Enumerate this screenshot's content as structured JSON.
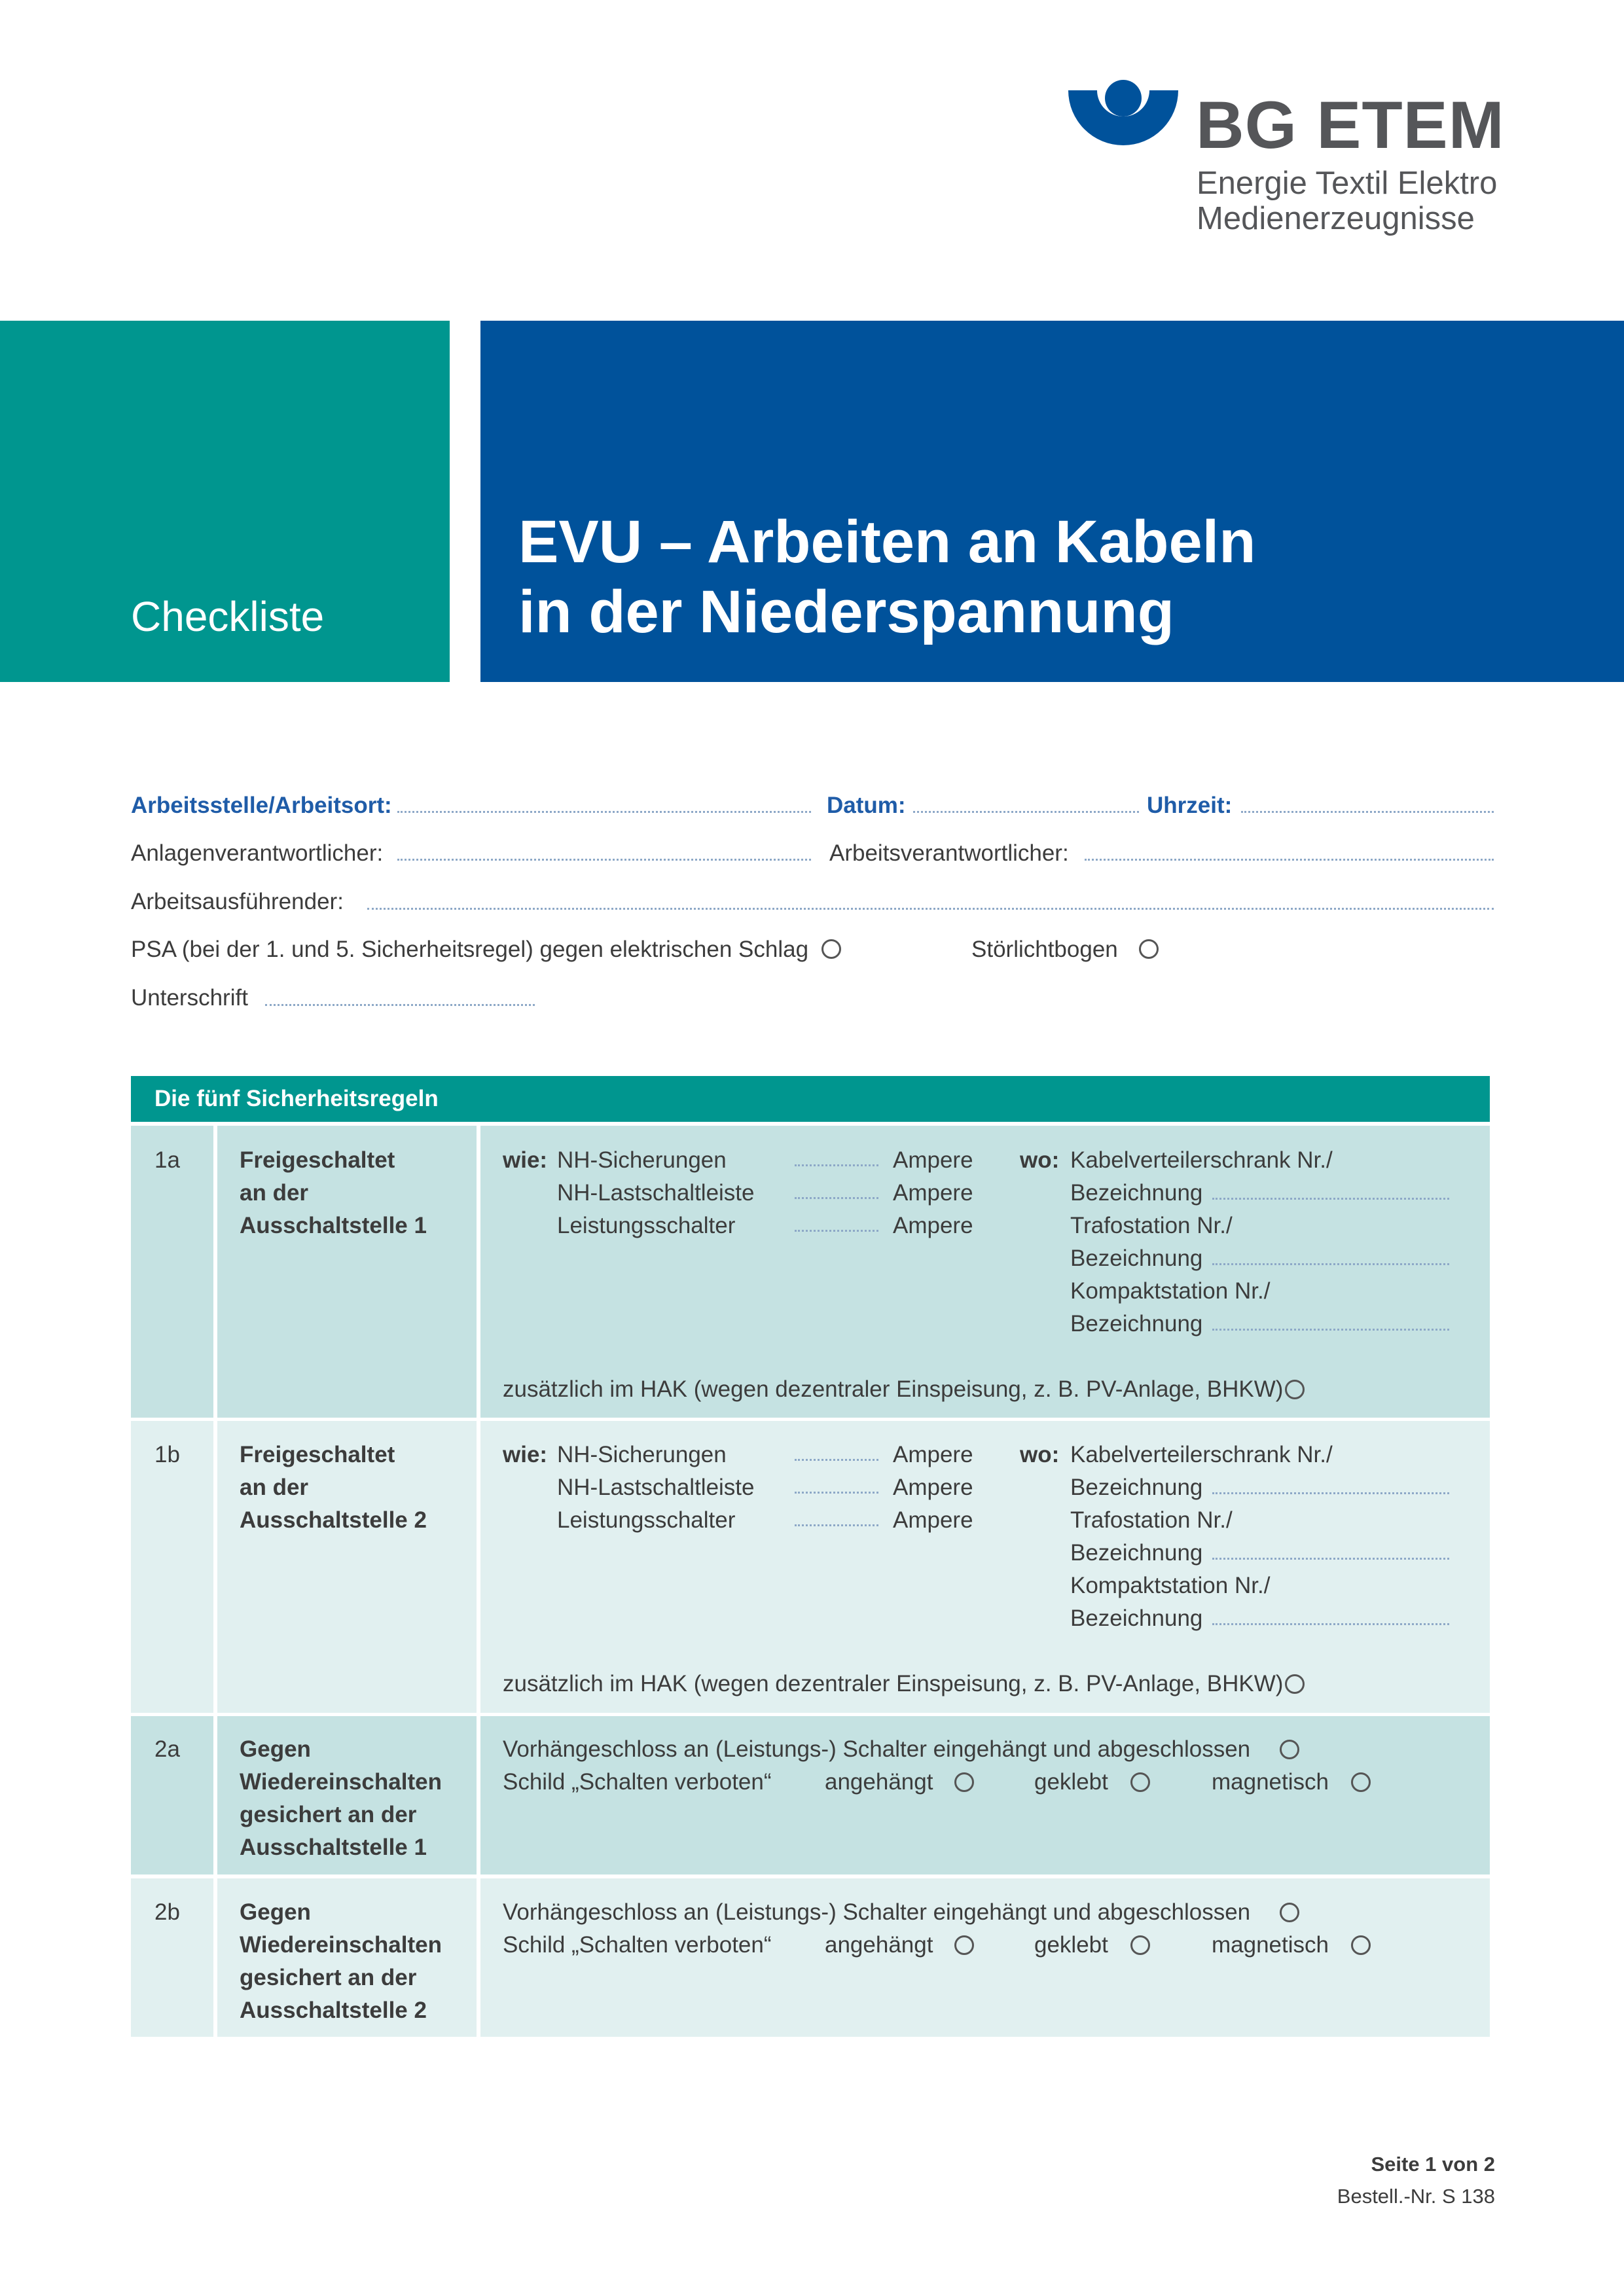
{
  "logo": {
    "title": "BG ETEM",
    "subtitle_line1": "Energie Textil Elektro",
    "subtitle_line2": "Medienerzeugnisse"
  },
  "banner": {
    "kind": "Checkliste",
    "title_line1": "EVU – Arbeiten an Kabeln",
    "title_line2": "in der Niederspannung",
    "colors": {
      "teal": "#00968f",
      "blue": "#00529b"
    }
  },
  "form": {
    "arbeitsstelle": "Arbeitsstelle/Arbeitsort:",
    "datum": "Datum:",
    "uhrzeit": "Uhrzeit:",
    "anlagenverantwortlicher": "Anlagenverantwortlicher:",
    "arbeitsverantwortlicher": "Arbeitsverantwortlicher:",
    "arbeitsausfuehrender": "Arbeitsausführender:",
    "psa": "PSA (bei der 1. und 5. Sicherheitsregel) gegen elektrischen Schlag",
    "stoerlichtbogen": "Störlichtbogen",
    "unterschrift": "Unterschrift"
  },
  "table": {
    "header": "Die fünf Sicherheitsregeln",
    "rows": [
      {
        "num": "1a",
        "title": [
          "Freigeschaltet",
          "an der",
          "Ausschaltstelle 1"
        ],
        "wie_label": "wie:",
        "wie_items": [
          "NH-Sicherungen",
          "NH-Lastschaltleiste",
          "Leistungsschalter"
        ],
        "unit": "Ampere",
        "wo_label": "wo:",
        "wo_items": [
          "Kabelverteilerschrank Nr./",
          "Bezeichnung",
          "Trafostation Nr./",
          "Bezeichnung",
          "Kompaktstation Nr./",
          "Bezeichnung"
        ],
        "extra": "zusätzlich im HAK (wegen dezentraler Einspeisung, z. B. PV-Anlage, BHKW)"
      },
      {
        "num": "1b",
        "title": [
          "Freigeschaltet",
          "an der",
          "Ausschaltstelle 2"
        ],
        "wie_label": "wie:",
        "wie_items": [
          "NH-Sicherungen",
          "NH-Lastschaltleiste",
          "Leistungsschalter"
        ],
        "unit": "Ampere",
        "wo_label": "wo:",
        "wo_items": [
          "Kabelverteilerschrank Nr./",
          "Bezeichnung",
          "Trafostation Nr./",
          "Bezeichnung",
          "Kompaktstation Nr./",
          "Bezeichnung"
        ],
        "extra": "zusätzlich im HAK (wegen dezentraler Einspeisung, z. B. PV-Anlage, BHKW)"
      },
      {
        "num": "2a",
        "title": [
          "Gegen",
          "Wiedereinschalten",
          "gesichert an der",
          "Ausschaltstelle 1"
        ],
        "lock": "Vorhängeschloss an (Leistungs-) Schalter eingehängt und abgeschlossen",
        "schild": "Schild „Schalten verboten“",
        "opt1": "angehängt",
        "opt2": "geklebt",
        "opt3": "magnetisch"
      },
      {
        "num": "2b",
        "title": [
          "Gegen",
          "Wiedereinschalten",
          "gesichert an der",
          "Ausschaltstelle 2"
        ],
        "lock": "Vorhängeschloss an (Leistungs-) Schalter eingehängt und abgeschlossen",
        "schild": "Schild „Schalten verboten“",
        "opt1": "angehängt",
        "opt2": "geklebt",
        "opt3": "magnetisch"
      }
    ]
  },
  "footer": {
    "page": "Seite 1 von 2",
    "order": "Bestell.-Nr. S 138"
  }
}
